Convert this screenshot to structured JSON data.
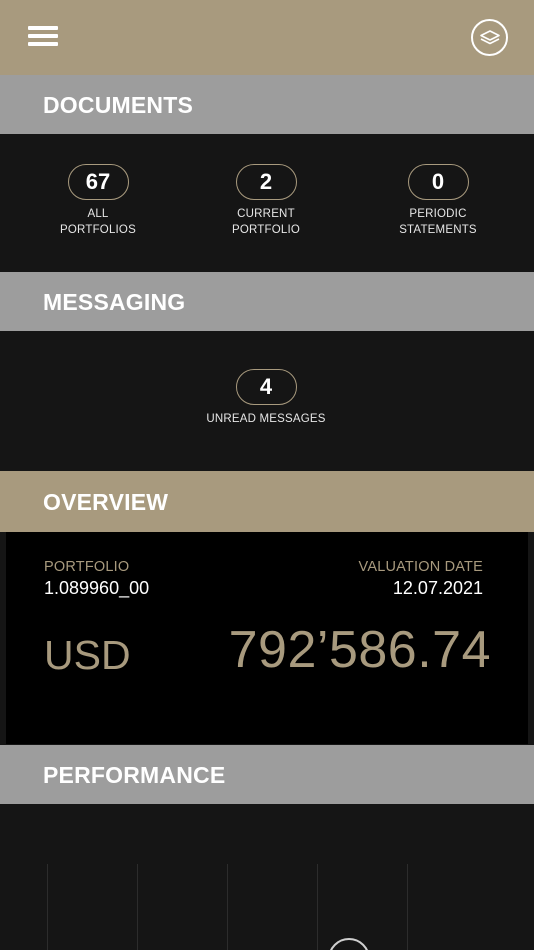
{
  "header": {
    "menu_icon": "hamburger-menu-icon",
    "logo_icon": "layers-logo-icon"
  },
  "documents": {
    "title": "DOCUMENTS",
    "stats": [
      {
        "count": "67",
        "label": "ALL\nPORTFOLIOS"
      },
      {
        "count": "2",
        "label": "CURRENT\nPORTFOLIO"
      },
      {
        "count": "0",
        "label": "PERIODIC\nSTATEMENTS"
      }
    ]
  },
  "messaging": {
    "title": "MESSAGING",
    "unread": {
      "count": "4",
      "label": "UNREAD MESSAGES"
    }
  },
  "overview": {
    "title": "OVERVIEW",
    "portfolio_label": "PORTFOLIO",
    "portfolio_value": "1.089960_00",
    "valuation_label": "VALUATION DATE",
    "valuation_value": "12.07.2021",
    "currency": "USD",
    "amount": "792’586.74"
  },
  "performance": {
    "title": "PERFORMANCE"
  },
  "colors": {
    "accent_gold": "#a89a7e",
    "section_gray": "#9d9d9d",
    "panel_dark": "#151515",
    "card_black": "#000000"
  }
}
